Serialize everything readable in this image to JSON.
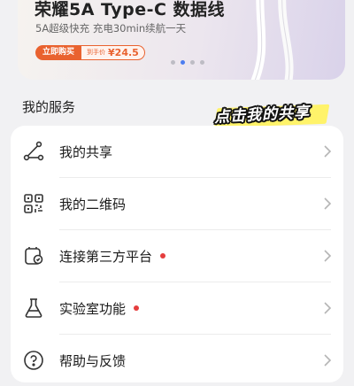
{
  "banner": {
    "title": "荣耀5A Type-C 数据线",
    "subtitle": "5A超级快充 充电30min续航一天",
    "buy_label": "立即购买",
    "price_label": "到手价",
    "price_value": "¥24.5",
    "carousel_dot_count": 4,
    "carousel_active_index": 1
  },
  "section": {
    "title": "我的服务",
    "annotation": "点击我的共享"
  },
  "services": [
    {
      "label": "我的共享",
      "icon": "share-icon",
      "has_red_dot": false
    },
    {
      "label": "我的二维码",
      "icon": "qr-code-icon",
      "has_red_dot": false
    },
    {
      "label": "连接第三方平台",
      "icon": "third-party-icon",
      "has_red_dot": true
    },
    {
      "label": "实验室功能",
      "icon": "flask-icon",
      "has_red_dot": true
    },
    {
      "label": "帮助与反馈",
      "icon": "help-icon",
      "has_red_dot": false
    }
  ],
  "colors": {
    "accent": "#e9622f",
    "red_dot": "#e53d3d",
    "annotation_highlight": "#fff36a",
    "active_dot": "#4c7df0"
  }
}
